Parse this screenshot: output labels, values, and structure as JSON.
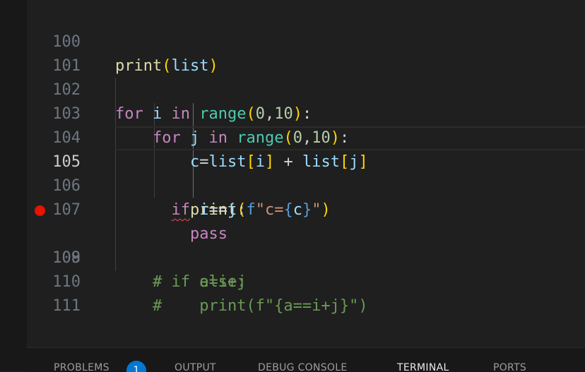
{
  "editor": {
    "top_fragment": {
      "p1": "(",
      "p2": ")"
    },
    "lines": [
      {
        "num": "100"
      },
      {
        "num": "101"
      },
      {
        "num": "102"
      },
      {
        "num": "103"
      },
      {
        "num": "104"
      },
      {
        "num": "105"
      },
      {
        "num": "106"
      },
      {
        "num": "107"
      },
      {
        "num": "108"
      },
      {
        "num": "109"
      },
      {
        "num": "110"
      },
      {
        "num": "111"
      }
    ],
    "l100": {
      "fn": "print",
      "arg": "list"
    },
    "l102": {
      "kw_for": "for",
      "var_i": "i",
      "kw_in": "in",
      "fn": "range",
      "a": "0",
      "b": "10"
    },
    "l103": {
      "kw_for": "for",
      "var_j": "j",
      "kw_in": "in",
      "fn": "range",
      "a": "0",
      "b": "10"
    },
    "l104": {
      "c": "c",
      "list1": "list",
      "i": "i",
      "list2": "list",
      "j": "j"
    },
    "l105": {
      "fn": "print",
      "prefix": "f",
      "str1": "\"c=",
      "c": "c",
      "str2": "\""
    },
    "l106": {
      "kw": "if",
      "expr_i": "i",
      "expr_j": "j"
    },
    "l107": {
      "kw": "pass"
    },
    "l108": {
      "comment": "# if else:"
    },
    "l109": {
      "comment": "#    a=i+j"
    },
    "l110": {
      "comment": "#    print(f\"{a==i+j}\")"
    }
  },
  "breakpoint_line": "108",
  "active_line": "105",
  "panel": {
    "tabs": [
      {
        "label": "PROBLEMS"
      },
      {
        "label": "OUTPUT"
      },
      {
        "label": "DEBUG CONSOLE"
      },
      {
        "label": "TERMINAL"
      },
      {
        "label": "PORTS"
      }
    ],
    "problems_count": "1",
    "active_tab": "TERMINAL"
  }
}
